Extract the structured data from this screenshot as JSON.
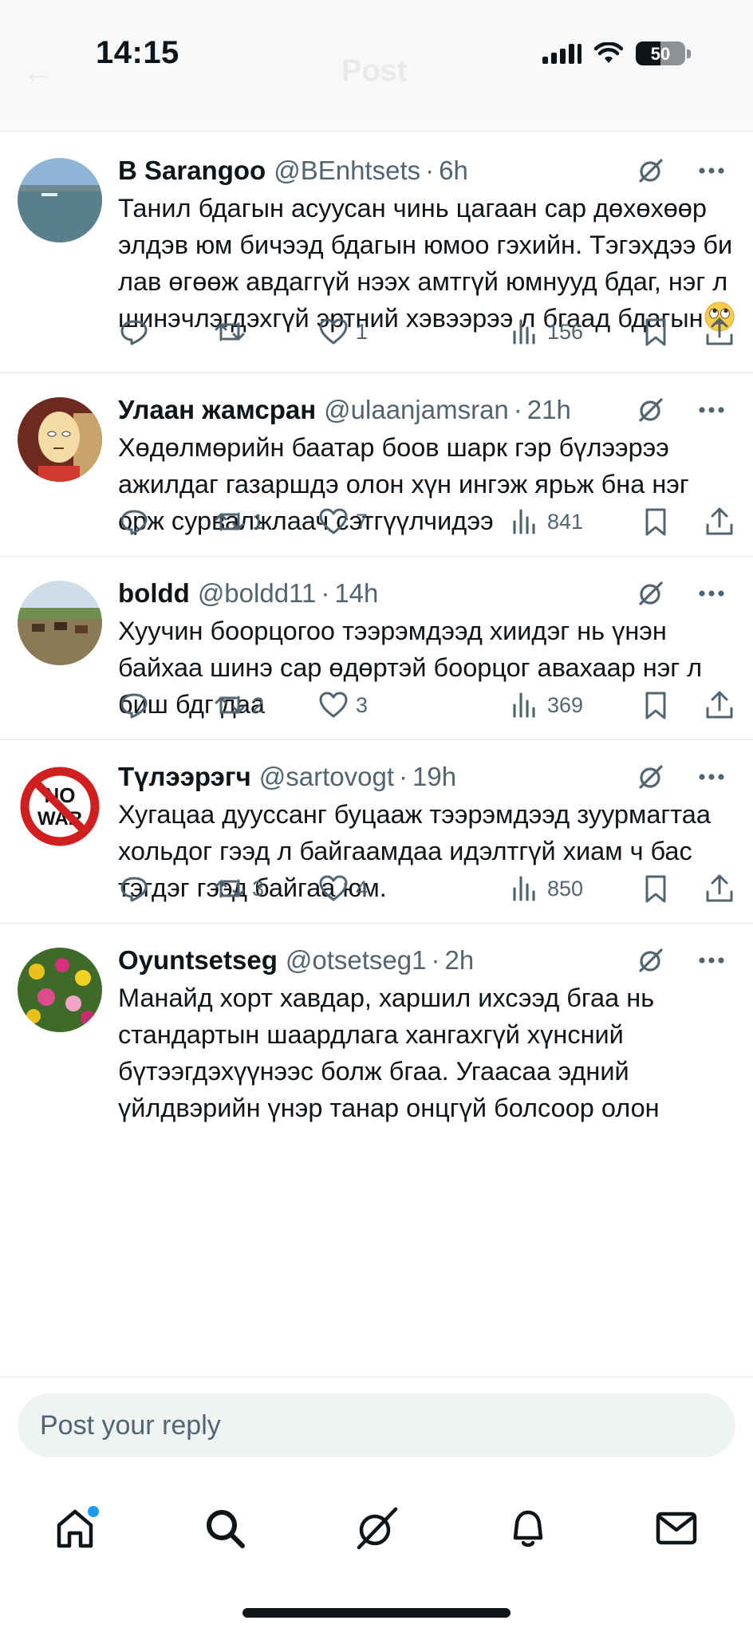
{
  "status_bar": {
    "time": "14:15",
    "battery": "50"
  },
  "header": {
    "title": "Post"
  },
  "tweets": [
    {
      "name": "B Sarangoo",
      "handle": "@BEnhtsets",
      "time": "6h",
      "text": "Танил бдагын асуусан чинь цагаан сар дөхөхөөр элдэв юм бичээд бдагын юмоо гэхийн. Тэгэхдээ би лав өгөөж авдаггүй нээх амтгүй юмнууд бдаг, нэг л шинэчлэгдэхгүй эртний хэвээрээ л бгаад бдагын",
      "emoji": "face-with-rolling-eyes",
      "replies": "",
      "reposts": "",
      "likes": "1",
      "views": "156"
    },
    {
      "name": "Улаан жамсран",
      "handle": "@ulaanjamsran",
      "time": "21h",
      "text": "Хөдөлмөрийн баатар боов шарк гэр бүлээрээ ажилдаг газаршдэ олон хүн ингэж ярьж бна нэг орж сурвалжлаач сэтгүүлчидээ",
      "replies": "",
      "reposts": "1",
      "likes": "7",
      "views": "841"
    },
    {
      "name": "boldd",
      "handle": "@boldd11",
      "time": "14h",
      "text": "Хуучин боорцогоо тээрэмдээд хиидэг нь үнэн байхаа шинэ сар өдөртэй боорцог авахаар нэг л биш бдг даа",
      "replies": "",
      "reposts": "2",
      "likes": "3",
      "views": "369"
    },
    {
      "name": "Түлээрэгч",
      "handle": "@sartovogt",
      "time": "19h",
      "text": "Хугацаа дууссанг буцааж тээрэмдээд зуурмагтаа хольдог гээд л байгаамдаа идэлтгүй хиам ч бас тэгдэг гээд байгаа юм.",
      "avatar_text": [
        "NO",
        "WAR"
      ],
      "replies": "",
      "reposts": "3",
      "likes": "4",
      "views": "850"
    },
    {
      "name": "Oyuntsetseg",
      "handle": "@otsetseg1",
      "time": "2h",
      "text": "Манайд хорт хавдар, харшил ихсээд бгаа нь стандартын шаардлага хангахгүй хүнсний бүтээгдэхүүнээс болж бгаа. Угаасаа эдний үйлдвэрийн үнэр танар онцгүй болсоор олон"
    }
  ],
  "reply": {
    "placeholder": "Post your reply"
  },
  "nav": {
    "active": "home",
    "icons": [
      "home-icon",
      "search-icon",
      "grok-icon",
      "notifications-icon",
      "messages-icon"
    ]
  },
  "colors": {
    "accent": "#1d9bf0",
    "text": "#0f1419",
    "secondary": "#536471",
    "divider": "#e7e9ea"
  }
}
